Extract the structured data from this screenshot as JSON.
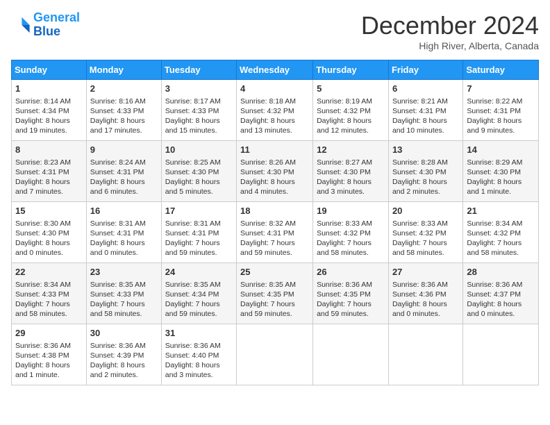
{
  "header": {
    "logo_line1": "General",
    "logo_line2": "Blue",
    "month": "December 2024",
    "location": "High River, Alberta, Canada"
  },
  "days_of_week": [
    "Sunday",
    "Monday",
    "Tuesday",
    "Wednesday",
    "Thursday",
    "Friday",
    "Saturday"
  ],
  "weeks": [
    [
      {
        "day": "1",
        "sunrise": "8:14 AM",
        "sunset": "4:34 PM",
        "daylight": "8 hours and 19 minutes."
      },
      {
        "day": "2",
        "sunrise": "8:16 AM",
        "sunset": "4:33 PM",
        "daylight": "8 hours and 17 minutes."
      },
      {
        "day": "3",
        "sunrise": "8:17 AM",
        "sunset": "4:33 PM",
        "daylight": "8 hours and 15 minutes."
      },
      {
        "day": "4",
        "sunrise": "8:18 AM",
        "sunset": "4:32 PM",
        "daylight": "8 hours and 13 minutes."
      },
      {
        "day": "5",
        "sunrise": "8:19 AM",
        "sunset": "4:32 PM",
        "daylight": "8 hours and 12 minutes."
      },
      {
        "day": "6",
        "sunrise": "8:21 AM",
        "sunset": "4:31 PM",
        "daylight": "8 hours and 10 minutes."
      },
      {
        "day": "7",
        "sunrise": "8:22 AM",
        "sunset": "4:31 PM",
        "daylight": "8 hours and 9 minutes."
      }
    ],
    [
      {
        "day": "8",
        "sunrise": "8:23 AM",
        "sunset": "4:31 PM",
        "daylight": "8 hours and 7 minutes."
      },
      {
        "day": "9",
        "sunrise": "8:24 AM",
        "sunset": "4:31 PM",
        "daylight": "8 hours and 6 minutes."
      },
      {
        "day": "10",
        "sunrise": "8:25 AM",
        "sunset": "4:30 PM",
        "daylight": "8 hours and 5 minutes."
      },
      {
        "day": "11",
        "sunrise": "8:26 AM",
        "sunset": "4:30 PM",
        "daylight": "8 hours and 4 minutes."
      },
      {
        "day": "12",
        "sunrise": "8:27 AM",
        "sunset": "4:30 PM",
        "daylight": "8 hours and 3 minutes."
      },
      {
        "day": "13",
        "sunrise": "8:28 AM",
        "sunset": "4:30 PM",
        "daylight": "8 hours and 2 minutes."
      },
      {
        "day": "14",
        "sunrise": "8:29 AM",
        "sunset": "4:30 PM",
        "daylight": "8 hours and 1 minute."
      }
    ],
    [
      {
        "day": "15",
        "sunrise": "8:30 AM",
        "sunset": "4:30 PM",
        "daylight": "8 hours and 0 minutes."
      },
      {
        "day": "16",
        "sunrise": "8:31 AM",
        "sunset": "4:31 PM",
        "daylight": "8 hours and 0 minutes."
      },
      {
        "day": "17",
        "sunrise": "8:31 AM",
        "sunset": "4:31 PM",
        "daylight": "7 hours and 59 minutes."
      },
      {
        "day": "18",
        "sunrise": "8:32 AM",
        "sunset": "4:31 PM",
        "daylight": "7 hours and 59 minutes."
      },
      {
        "day": "19",
        "sunrise": "8:33 AM",
        "sunset": "4:32 PM",
        "daylight": "7 hours and 58 minutes."
      },
      {
        "day": "20",
        "sunrise": "8:33 AM",
        "sunset": "4:32 PM",
        "daylight": "7 hours and 58 minutes."
      },
      {
        "day": "21",
        "sunrise": "8:34 AM",
        "sunset": "4:32 PM",
        "daylight": "7 hours and 58 minutes."
      }
    ],
    [
      {
        "day": "22",
        "sunrise": "8:34 AM",
        "sunset": "4:33 PM",
        "daylight": "7 hours and 58 minutes."
      },
      {
        "day": "23",
        "sunrise": "8:35 AM",
        "sunset": "4:33 PM",
        "daylight": "7 hours and 58 minutes."
      },
      {
        "day": "24",
        "sunrise": "8:35 AM",
        "sunset": "4:34 PM",
        "daylight": "7 hours and 59 minutes."
      },
      {
        "day": "25",
        "sunrise": "8:35 AM",
        "sunset": "4:35 PM",
        "daylight": "7 hours and 59 minutes."
      },
      {
        "day": "26",
        "sunrise": "8:36 AM",
        "sunset": "4:35 PM",
        "daylight": "7 hours and 59 minutes."
      },
      {
        "day": "27",
        "sunrise": "8:36 AM",
        "sunset": "4:36 PM",
        "daylight": "8 hours and 0 minutes."
      },
      {
        "day": "28",
        "sunrise": "8:36 AM",
        "sunset": "4:37 PM",
        "daylight": "8 hours and 0 minutes."
      }
    ],
    [
      {
        "day": "29",
        "sunrise": "8:36 AM",
        "sunset": "4:38 PM",
        "daylight": "8 hours and 1 minute."
      },
      {
        "day": "30",
        "sunrise": "8:36 AM",
        "sunset": "4:39 PM",
        "daylight": "8 hours and 2 minutes."
      },
      {
        "day": "31",
        "sunrise": "8:36 AM",
        "sunset": "4:40 PM",
        "daylight": "8 hours and 3 minutes."
      },
      null,
      null,
      null,
      null
    ]
  ]
}
